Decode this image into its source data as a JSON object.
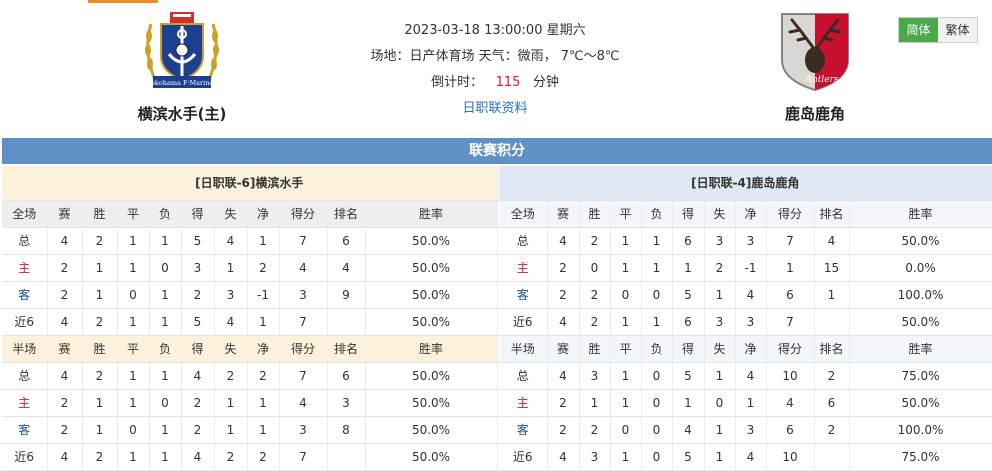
{
  "match": {
    "datetime": "2023-03-18 13:00:00 星期六",
    "venue_line": "场地：日产体育场 天气：微雨， 7℃～8℃",
    "countdown_label": "倒计时：",
    "countdown_value": "115",
    "countdown_unit": "分钟",
    "league_link": "日职联资料"
  },
  "home_team": {
    "name": "横滨水手(主)",
    "logo_text": "Yokohama F·Marinos"
  },
  "away_team": {
    "name": "鹿岛鹿角",
    "logo_text": "Antlers"
  },
  "lang": {
    "simplified": "简体",
    "traditional": "繁体"
  },
  "colors": {
    "title_bar": "#5f91c7",
    "home_caption": "#fcf2dc",
    "away_caption": "#dfe8f3",
    "home_row_text": "#d02020",
    "away_row_text": "#1f4fa8",
    "active_lang": "#4aa94a"
  },
  "section_title": "联赛积分",
  "home_table": {
    "caption": "[日职联-6]横滨水手",
    "full_headers": [
      "全场",
      "赛",
      "胜",
      "平",
      "负",
      "得",
      "失",
      "净",
      "得分",
      "排名",
      "胜率"
    ],
    "full_rows": [
      [
        "总",
        "4",
        "2",
        "1",
        "1",
        "5",
        "4",
        "1",
        "7",
        "6",
        "50.0%"
      ],
      [
        "主",
        "2",
        "1",
        "1",
        "0",
        "3",
        "1",
        "2",
        "4",
        "4",
        "50.0%"
      ],
      [
        "客",
        "2",
        "1",
        "0",
        "1",
        "2",
        "3",
        "-1",
        "3",
        "9",
        "50.0%"
      ],
      [
        "近6",
        "4",
        "2",
        "1",
        "1",
        "5",
        "4",
        "1",
        "7",
        "",
        "50.0%"
      ]
    ],
    "half_headers": [
      "半场",
      "赛",
      "胜",
      "平",
      "负",
      "得",
      "失",
      "净",
      "得分",
      "排名",
      "胜率"
    ],
    "half_rows": [
      [
        "总",
        "4",
        "2",
        "1",
        "1",
        "4",
        "2",
        "2",
        "7",
        "6",
        "50.0%"
      ],
      [
        "主",
        "2",
        "1",
        "1",
        "0",
        "2",
        "1",
        "1",
        "4",
        "3",
        "50.0%"
      ],
      [
        "客",
        "2",
        "1",
        "0",
        "1",
        "2",
        "1",
        "1",
        "3",
        "8",
        "50.0%"
      ],
      [
        "近6",
        "4",
        "2",
        "1",
        "1",
        "4",
        "2",
        "2",
        "7",
        "",
        "50.0%"
      ]
    ]
  },
  "away_table": {
    "caption": "[日职联-4]鹿岛鹿角",
    "full_headers": [
      "全场",
      "赛",
      "胜",
      "平",
      "负",
      "得",
      "失",
      "净",
      "得分",
      "排名",
      "胜率"
    ],
    "full_rows": [
      [
        "总",
        "4",
        "2",
        "1",
        "1",
        "6",
        "3",
        "3",
        "7",
        "4",
        "50.0%"
      ],
      [
        "主",
        "2",
        "0",
        "1",
        "1",
        "1",
        "2",
        "-1",
        "1",
        "15",
        "0.0%"
      ],
      [
        "客",
        "2",
        "2",
        "0",
        "0",
        "5",
        "1",
        "4",
        "6",
        "1",
        "100.0%"
      ],
      [
        "近6",
        "4",
        "2",
        "1",
        "1",
        "6",
        "3",
        "3",
        "7",
        "",
        "50.0%"
      ]
    ],
    "half_headers": [
      "半场",
      "赛",
      "胜",
      "平",
      "负",
      "得",
      "失",
      "净",
      "得分",
      "排名",
      "胜率"
    ],
    "half_rows": [
      [
        "总",
        "4",
        "3",
        "1",
        "0",
        "5",
        "1",
        "4",
        "10",
        "2",
        "75.0%"
      ],
      [
        "主",
        "2",
        "1",
        "1",
        "0",
        "1",
        "0",
        "1",
        "4",
        "6",
        "50.0%"
      ],
      [
        "客",
        "2",
        "2",
        "0",
        "0",
        "4",
        "1",
        "3",
        "6",
        "2",
        "100.0%"
      ],
      [
        "近6",
        "4",
        "3",
        "1",
        "0",
        "5",
        "1",
        "4",
        "10",
        "",
        "75.0%"
      ]
    ]
  }
}
